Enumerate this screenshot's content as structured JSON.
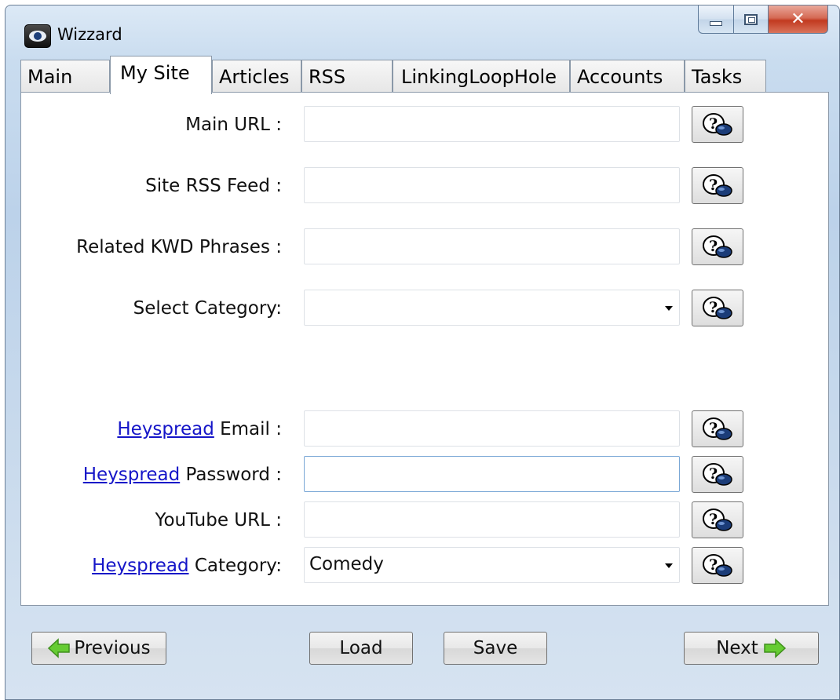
{
  "window": {
    "title": "Wizzard"
  },
  "tabs": [
    {
      "label": "Main",
      "active": false
    },
    {
      "label": "My Site",
      "active": true
    },
    {
      "label": "Articles",
      "active": false
    },
    {
      "label": "RSS",
      "active": false
    },
    {
      "label": "LinkingLoopHole",
      "active": false
    },
    {
      "label": "Accounts",
      "active": false
    },
    {
      "label": "Tasks",
      "active": false
    }
  ],
  "form": {
    "main_url": {
      "label": "Main URL :",
      "value": ""
    },
    "site_rss_feed": {
      "label": "Site RSS Feed :",
      "value": ""
    },
    "related_kwd_phrases": {
      "label": "Related KWD Phrases :",
      "value": ""
    },
    "select_category": {
      "label": "Select Category:",
      "value": ""
    },
    "heyspread_email": {
      "link": "Heyspread",
      "label": "Email :",
      "value": ""
    },
    "heyspread_password": {
      "link": "Heyspread",
      "label": "Password :",
      "value": ""
    },
    "youtube_url": {
      "label": "YouTube URL :",
      "value": ""
    },
    "heyspread_category": {
      "link": "Heyspread",
      "label": "Category:",
      "value": "Comedy"
    }
  },
  "buttons": {
    "previous": "Previous",
    "load": "Load",
    "save": "Save",
    "next": "Next"
  },
  "icons": {
    "app": "eye-app-icon",
    "help": "help-question-icon",
    "previous": "arrow-left-icon",
    "next": "arrow-right-icon"
  },
  "colors": {
    "link": "#1515c8",
    "arrow": "#66cc33",
    "close": "#c2391f"
  }
}
